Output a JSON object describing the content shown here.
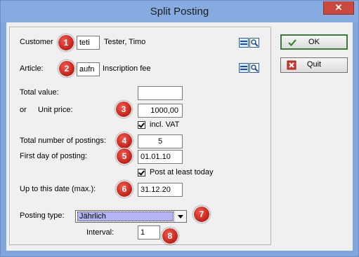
{
  "window": {
    "title": "Split Posting",
    "close_label": "✕"
  },
  "form": {
    "customer": {
      "label": "Customer",
      "code": "teti",
      "name": "Tester, Timo"
    },
    "article": {
      "label": "Article:",
      "code": "aufn",
      "name": "Inscription fee"
    },
    "total_value": {
      "label": "Total value:",
      "value": ""
    },
    "unit_price": {
      "prefix": "or",
      "label": "Unit price:",
      "value": "1000,00"
    },
    "incl_vat": {
      "label": "incl. VAT",
      "checked": true
    },
    "total_postings": {
      "label": "Total number of postings:",
      "value": "5"
    },
    "first_day": {
      "label": "First day of posting:",
      "value": "01.01.10"
    },
    "post_today": {
      "label": "Post at least today",
      "checked": true
    },
    "up_to_date": {
      "label": "Up to this date (max.):",
      "value": "31.12.20"
    },
    "posting_type": {
      "label": "Posting type:",
      "selected": "Jährlich"
    },
    "interval": {
      "label": "Interval:",
      "value": "1"
    }
  },
  "badges": [
    "1",
    "2",
    "3",
    "4",
    "5",
    "6",
    "7",
    "8"
  ],
  "buttons": {
    "ok": "OK",
    "quit": "Quit"
  },
  "colors": {
    "accent": "#c31f17",
    "title_bar": "#86abe0",
    "select_highlight": "#b4b4f4"
  }
}
